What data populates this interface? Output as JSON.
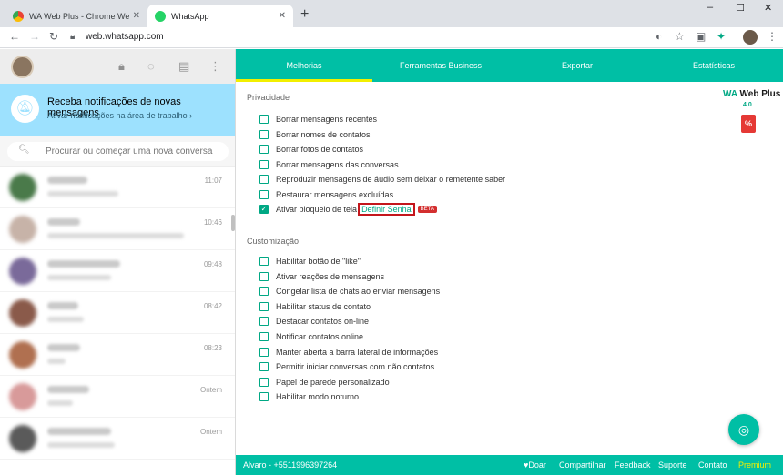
{
  "browser": {
    "tabs": [
      {
        "title": "WA Web Plus - Chrome Web Sto",
        "active": false
      },
      {
        "title": "WhatsApp",
        "active": true
      }
    ],
    "new_tab": "+",
    "url": "web.whatsapp.com",
    "window_controls": {
      "minimize": "–",
      "maximize": "☐",
      "close": "✕"
    }
  },
  "left_panel": {
    "notification": {
      "title": "Receba notificações de novas mensagens",
      "subtitle": "Ativar notificações na área de trabalho ›"
    },
    "search": {
      "placeholder": "Procurar ou começar uma nova conversa"
    },
    "chats": [
      {
        "time": "11:07",
        "color": "#4a7a4a",
        "name_w": 44,
        "msg_w": 78
      },
      {
        "time": "10:46",
        "color": "#c7b3a8",
        "name_w": 36,
        "msg_w": 150
      },
      {
        "time": "09:48",
        "color": "#7a6a9a",
        "name_w": 80,
        "msg_w": 70
      },
      {
        "time": "08:42",
        "color": "#8a5a4a",
        "name_w": 34,
        "msg_w": 40
      },
      {
        "time": "08:23",
        "color": "#b07050",
        "name_w": 36,
        "msg_w": 20
      },
      {
        "time": "Ontem",
        "color": "#d89a9a",
        "name_w": 46,
        "msg_w": 28
      },
      {
        "time": "Ontem",
        "color": "#5a5a5a",
        "name_w": 70,
        "msg_w": 74
      }
    ]
  },
  "right_panel": {
    "nav_tabs": [
      "Melhorias",
      "Ferramentas Business",
      "Exportar",
      "Estatísticas"
    ],
    "active_tab": 0,
    "logo": {
      "name_prefix": "WA",
      "name_suffix": " Web Plus",
      "version": "4.0"
    },
    "privacy": {
      "title": "Privacidade",
      "options": [
        {
          "label": "Borrar mensagens recentes",
          "checked": false
        },
        {
          "label": "Borrar nomes de contatos",
          "checked": false
        },
        {
          "label": "Borrar fotos de contatos",
          "checked": false
        },
        {
          "label": "Borrar mensagens das conversas",
          "checked": false
        },
        {
          "label": "Reproduzir mensagens de áudio sem deixar o remetente saber",
          "checked": false
        },
        {
          "label": "Restaurar mensagens excluídas",
          "checked": false
        }
      ],
      "lock_option": {
        "label": "Ativar bloqueio de tela",
        "checked": true,
        "link": "Definir Senha",
        "badge": "BETA"
      }
    },
    "customization": {
      "title": "Customização",
      "options": [
        {
          "label": "Habilitar botão de \"like\"",
          "checked": false
        },
        {
          "label": "Ativar reações de mensagens",
          "checked": false
        },
        {
          "label": "Congelar lista de chats ao enviar mensagens",
          "checked": false
        },
        {
          "label": "Habilitar status de contato",
          "checked": false
        },
        {
          "label": "Destacar contatos on-line",
          "checked": false
        },
        {
          "label": "Notificar contatos online",
          "checked": false
        },
        {
          "label": "Manter aberta a barra lateral de informações",
          "checked": false
        },
        {
          "label": "Permitir iniciar conversas com não contatos",
          "checked": false
        },
        {
          "label": "Papel de parede personalizado",
          "checked": false
        },
        {
          "label": "Habilitar modo noturno",
          "checked": false
        }
      ]
    },
    "footer": {
      "user": "Alvaro - +5511996397264",
      "links": [
        "♥Doar",
        "Compartilhar",
        "Feedback",
        "Suporte",
        "Contato"
      ],
      "premium": "Premium"
    }
  },
  "colors": {
    "teal": "#00bfa5",
    "green": "#00a884",
    "yellow": "#f2ef00",
    "notif_bg": "#9de1fe",
    "highlight": "#c4161c"
  }
}
